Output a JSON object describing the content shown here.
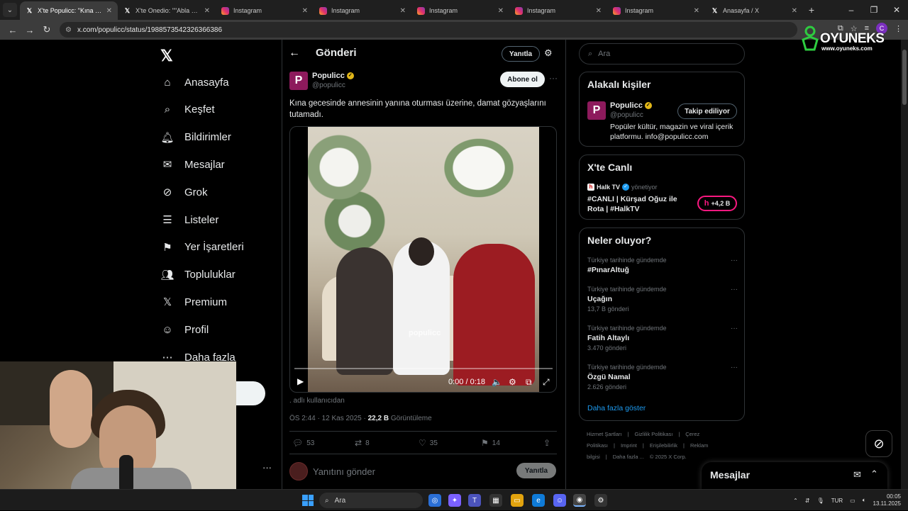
{
  "browser": {
    "tabs": [
      {
        "title": "X'te Populicc: \"Kına gecesi",
        "icon": "x-icon",
        "active": true
      },
      {
        "title": "X'te Onedio: \"\"Abla evlen",
        "icon": "x-icon",
        "active": false
      },
      {
        "title": "Instagram",
        "icon": "instagram-icon",
        "active": false
      },
      {
        "title": "Instagram",
        "icon": "instagram-icon",
        "active": false
      },
      {
        "title": "Instagram",
        "icon": "instagram-icon",
        "active": false
      },
      {
        "title": "Instagram",
        "icon": "instagram-icon",
        "active": false
      },
      {
        "title": "Instagram",
        "icon": "instagram-icon",
        "active": false
      },
      {
        "title": "Anasayfa / X",
        "icon": "x-icon",
        "active": false
      }
    ],
    "url": "x.com/populicc/status/1988573542326366386"
  },
  "watermark": {
    "brand": "OYUNEKS",
    "site": "www.oyuneks.com"
  },
  "nav": {
    "items": [
      {
        "label": "Anasayfa",
        "icon": "home-icon"
      },
      {
        "label": "Keşfet",
        "icon": "search-icon"
      },
      {
        "label": "Bildirimler",
        "icon": "bell-icon"
      },
      {
        "label": "Mesajlar",
        "icon": "mail-icon"
      },
      {
        "label": "Grok",
        "icon": "grok-icon"
      },
      {
        "label": "Listeler",
        "icon": "list-icon"
      },
      {
        "label": "Yer İşaretleri",
        "icon": "bookmark-icon"
      },
      {
        "label": "Topluluklar",
        "icon": "people-icon"
      },
      {
        "label": "Premium",
        "icon": "x-icon"
      },
      {
        "label": "Profil",
        "icon": "profile-icon"
      },
      {
        "label": "Daha fazla",
        "icon": "more-icon"
      }
    ],
    "post_button": "a"
  },
  "post": {
    "header_title": "Gönderi",
    "reply_pill": "Yanıtla",
    "author_name": "Populicc",
    "author_handle": "@populicc",
    "follow_label": "Abone ol",
    "text": "Kına gecesinde annesinin yanına oturması üzerine, damat gözyaşlarını tutamadı.",
    "video": {
      "time": "0:00 / 0:18",
      "progress": 0.0,
      "watermark": "populicc"
    },
    "from_user": ". adlı kullanıcıdan",
    "timestamp": "ÖS 2:44 · 12 Kas 2025 · ",
    "views_count": "22,2 B",
    "views_label": " Görüntüleme",
    "replies": "53",
    "reposts": "8",
    "likes": "35",
    "bookmarks": "14",
    "reply_placeholder": "Yanıtını gönder",
    "reply_button": "Yanıtla"
  },
  "sidebar": {
    "search_placeholder": "Ara",
    "related": {
      "title": "Alakalı kişiler",
      "name": "Populicc",
      "handle": "@populicc",
      "button": "Takip ediliyor",
      "bio": "Popüler kültür, magazin ve viral içerik platformu. info@populicc.com"
    },
    "live": {
      "title": "X'te Canlı",
      "host": "Halk TV",
      "host_suffix": "yönetiyor",
      "stream_title": "#CANLI | Kürşad Oğuz ile Rota | #HalkTV",
      "listeners": "+4,2 B"
    },
    "trends": {
      "title": "Neler oluyor?",
      "items": [
        {
          "context": "Türkiye tarihinde gündemde",
          "name": "#PınarAltuğ",
          "count": ""
        },
        {
          "context": "Türkiye tarihinde gündemde",
          "name": "Uçağın",
          "count": "13,7 B gönderi"
        },
        {
          "context": "Türkiye tarihinde gündemde",
          "name": "Fatih Altaylı",
          "count": "3.470 gönderi"
        },
        {
          "context": "Türkiye tarihinde gündemde",
          "name": "Özgü Namal",
          "count": "2.626 gönderi"
        }
      ],
      "show_more": "Daha fazla göster"
    },
    "footer": [
      "Hizmet Şartları",
      "|",
      "Gizlilik Politikası",
      "|",
      "Çerez Politikası",
      "|",
      "Imprint",
      "|",
      "Erişilebilirlik",
      "|",
      "Reklam bilgisi",
      "|",
      "Daha fazla ...",
      "© 2025 X Corp."
    ]
  },
  "messages_drawer": {
    "title": "Mesajlar"
  },
  "taskbar": {
    "search": "Ara",
    "lang": "TUR",
    "time": "00:05",
    "date": "13.11.2025"
  }
}
